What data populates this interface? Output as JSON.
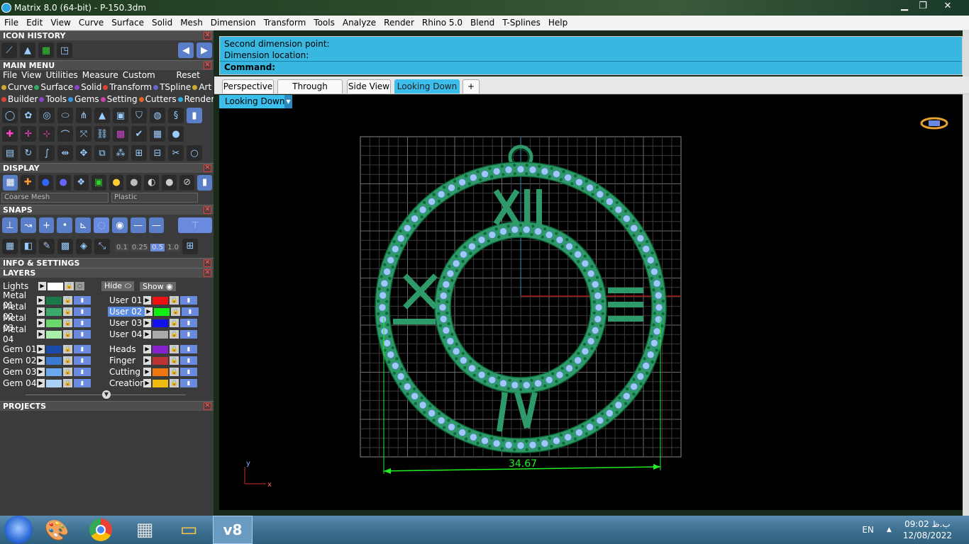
{
  "window": {
    "title": "Matrix 8.0 (64-bit) - P-150.3dm",
    "min": "▁",
    "max": "❐",
    "close": "✕"
  },
  "menubar": [
    "File",
    "Edit",
    "View",
    "Curve",
    "Surface",
    "Solid",
    "Mesh",
    "Dimension",
    "Transform",
    "Tools",
    "Analyze",
    "Render",
    "Rhino 5.0",
    "Blend",
    "T-Splines",
    "Help"
  ],
  "left": {
    "icon_history": "ICON HISTORY",
    "main_menu": "MAIN MENU",
    "main_menu_items": [
      "File",
      "View",
      "Utilities",
      "Measure",
      "Custom"
    ],
    "reset": "Reset",
    "cats_row1": [
      {
        "label": "Curve",
        "color": "#ccaa33"
      },
      {
        "label": "Surface",
        "color": "#33aa66"
      },
      {
        "label": "Solid",
        "color": "#8844cc"
      },
      {
        "label": "Transform",
        "color": "#dd4433"
      },
      {
        "label": "TSpline",
        "color": "#6666cc"
      },
      {
        "label": "Art",
        "color": "#ccaa33"
      }
    ],
    "cats_row2": [
      {
        "label": "Builder",
        "color": "#dd4433"
      },
      {
        "label": "Tools",
        "color": "#8844cc"
      },
      {
        "label": "Gems",
        "color": "#3399dd"
      },
      {
        "label": "Setting",
        "color": "#cc44aa"
      },
      {
        "label": "Cutters",
        "color": "#dd6622"
      },
      {
        "label": "Render",
        "color": "#33aadd"
      }
    ],
    "display": "DISPLAY",
    "display_combo1": "Coarse Mesh",
    "display_combo2": "Plastic",
    "snaps": "SNAPS",
    "snap_values": [
      "0.1",
      "0.25",
      "0.5",
      "1.0"
    ],
    "info_settings": "INFO & SETTINGS",
    "layers": "LAYERS",
    "lights": "Lights",
    "hide": "Hide",
    "show": "Show",
    "layers_left": [
      {
        "name": "Metal 01",
        "color": "#1a7a4a"
      },
      {
        "name": "Metal 02",
        "color": "#3aaa6a"
      },
      {
        "name": "Metal 03",
        "color": "#6ad86a"
      },
      {
        "name": "Metal 04",
        "color": "#aaf0aa"
      },
      {
        "name": "Gem 01",
        "color": "#1a4aaa"
      },
      {
        "name": "Gem 02",
        "color": "#3a7ad0"
      },
      {
        "name": "Gem 03",
        "color": "#6aa8f0"
      },
      {
        "name": "Gem 04",
        "color": "#aad0f8"
      }
    ],
    "layers_right": [
      {
        "name": "User 01",
        "color": "#ee1111"
      },
      {
        "name": "User 02",
        "color": "#11ee11"
      },
      {
        "name": "User 03",
        "color": "#1111ee"
      },
      {
        "name": "User 04",
        "color": "#aaaaaa"
      },
      {
        "name": "Heads",
        "color": "#8822cc"
      },
      {
        "name": "Finger",
        "color": "#bb3333"
      },
      {
        "name": "Cutting",
        "color": "#ee7711"
      },
      {
        "name": "Creation",
        "color": "#eebb11"
      }
    ],
    "projects": "PROJECTS"
  },
  "command": {
    "line1": "Second dimension point:",
    "line2": "Dimension location:",
    "prompt": "Command:"
  },
  "tabs": [
    "Perspective",
    "Through Finger",
    "Side View",
    "Looking Down"
  ],
  "active_tab": "Looking Down",
  "tab_add": "+",
  "viewport": {
    "name": "Looking Down",
    "dimension": "34.67",
    "axis_y": "y",
    "axis_x": "x",
    "grid_color": "#8a8a8a",
    "model_color": "#2e9a6a",
    "gem_color": "#9ec8f8",
    "prong_color": "#0e6a3a",
    "dim_color": "#22ee22"
  },
  "taskbar": {
    "lang": "EN",
    "time": "09:02 ب.ظ",
    "date": "12/08/2022",
    "app_v8": "v8"
  }
}
